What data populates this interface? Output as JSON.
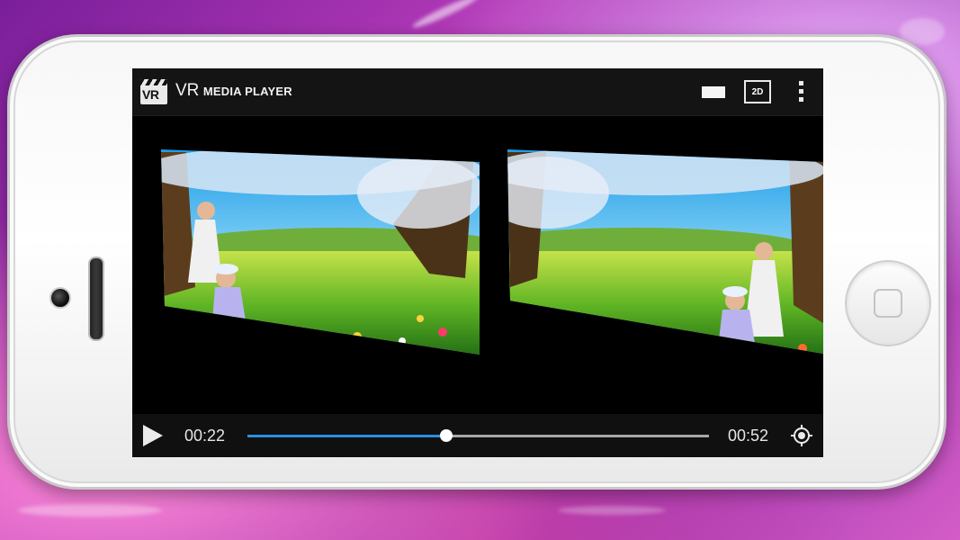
{
  "app": {
    "logo_text": "VR",
    "title_main": "VR",
    "title_sub": "MEDIA PLAYER"
  },
  "toolbar": {
    "screen_mode_icon": "rectangle-icon",
    "mode_label": "2D",
    "more_icon": "more-vert-icon"
  },
  "player": {
    "play_icon": "play-icon",
    "current_time": "00:22",
    "total_time": "00:52",
    "progress": 0.43,
    "recenter_icon": "gps-fixed-icon"
  },
  "colors": {
    "accent": "#2b8fe0",
    "toolbar_bg": "#141414",
    "background": "#9a2fae"
  }
}
